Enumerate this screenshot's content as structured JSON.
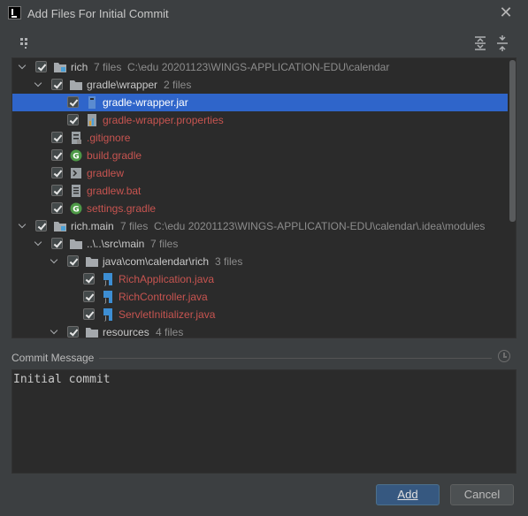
{
  "window": {
    "title": "Add Files For Initial Commit"
  },
  "colors": {
    "selection": "#2f65ca",
    "unversioned_file": "#c75450",
    "button_primary": "#365880"
  },
  "tree": [
    {
      "name": "rich",
      "meta": "7 files",
      "path": "C:\\edu 20201123\\WINGS-APPLICATION-EDU\\calendar",
      "icon": "module-icon",
      "level": 0,
      "expanded": true,
      "style": "norm"
    },
    {
      "name": "gradle\\wrapper",
      "meta": "2 files",
      "path": "",
      "icon": "folder-icon",
      "level": 1,
      "expanded": true,
      "style": "norm"
    },
    {
      "name": "gradle-wrapper.jar",
      "meta": "",
      "path": "",
      "icon": "jar-icon",
      "level": 2,
      "expanded": false,
      "style": "white",
      "selected": true
    },
    {
      "name": "gradle-wrapper.properties",
      "meta": "",
      "path": "",
      "icon": "properties-icon",
      "level": 2,
      "expanded": false,
      "style": "red"
    },
    {
      "name": ".gitignore",
      "meta": "",
      "path": "",
      "icon": "gitignore-icon",
      "level": 1,
      "expanded": false,
      "style": "red"
    },
    {
      "name": "build.gradle",
      "meta": "",
      "path": "",
      "icon": "gradle-icon",
      "level": 1,
      "expanded": false,
      "style": "red"
    },
    {
      "name": "gradlew",
      "meta": "",
      "path": "",
      "icon": "shell-icon",
      "level": 1,
      "expanded": false,
      "style": "red"
    },
    {
      "name": "gradlew.bat",
      "meta": "",
      "path": "",
      "icon": "text-file-icon",
      "level": 1,
      "expanded": false,
      "style": "red"
    },
    {
      "name": "settings.gradle",
      "meta": "",
      "path": "",
      "icon": "gradle-icon",
      "level": 1,
      "expanded": false,
      "style": "red"
    },
    {
      "name": "rich.main",
      "meta": "7 files",
      "path": "C:\\edu 20201123\\WINGS-APPLICATION-EDU\\calendar\\.idea\\modules",
      "icon": "module-icon",
      "level": 0,
      "expanded": true,
      "style": "norm"
    },
    {
      "name": "..\\..\\src\\main",
      "meta": "7 files",
      "path": "",
      "icon": "folder-icon",
      "level": 1,
      "expanded": true,
      "style": "norm"
    },
    {
      "name": "java\\com\\calendar\\rich",
      "meta": "3 files",
      "path": "",
      "icon": "folder-icon",
      "level": 2,
      "expanded": true,
      "style": "norm"
    },
    {
      "name": "RichApplication.java",
      "meta": "",
      "path": "",
      "icon": "java-icon",
      "level": 3,
      "expanded": false,
      "style": "red"
    },
    {
      "name": "RichController.java",
      "meta": "",
      "path": "",
      "icon": "java-icon",
      "level": 3,
      "expanded": false,
      "style": "red"
    },
    {
      "name": "ServletInitializer.java",
      "meta": "",
      "path": "",
      "icon": "java-icon",
      "level": 3,
      "expanded": false,
      "style": "red"
    },
    {
      "name": "resources",
      "meta": "4 files",
      "path": "",
      "icon": "folder-icon",
      "level": 2,
      "expanded": true,
      "style": "norm"
    }
  ],
  "commit": {
    "label": "Commit Message",
    "message": "Initial commit"
  },
  "buttons": {
    "add": "Add",
    "cancel": "Cancel"
  }
}
